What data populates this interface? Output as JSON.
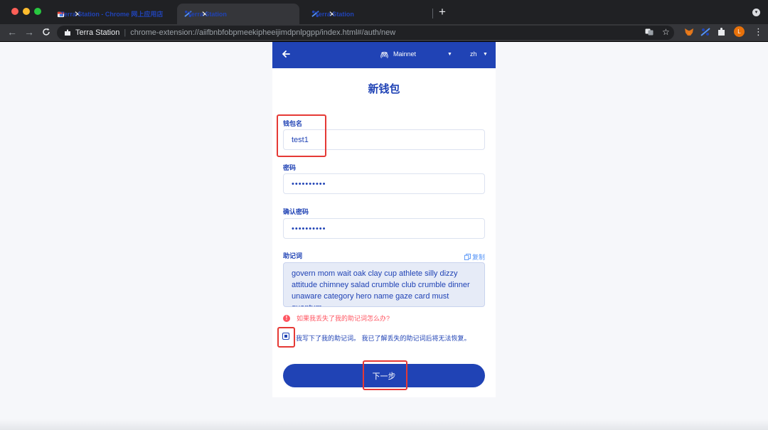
{
  "browser": {
    "tabs": [
      {
        "title": "Terra Station - Chrome 网上应用店",
        "active": false
      },
      {
        "title": "Terra Station",
        "active": true
      },
      {
        "title": "Terra Station",
        "active": false
      }
    ],
    "omnibox": {
      "site": "Terra Station",
      "url": "chrome-extension://aiifbnbfobpmeekipheeijimdpnlpgpp/index.html#/auth/new"
    },
    "avatar_letter": "L"
  },
  "header": {
    "network": "Mainnet",
    "language": "zh"
  },
  "form": {
    "title": "新钱包",
    "wallet_name_label": "钱包名",
    "wallet_name_value": "test1",
    "password_label": "密码",
    "password_value": "••••••••••",
    "confirm_label": "确认密码",
    "confirm_value": "••••••••••",
    "mnemonic_label": "助记词",
    "copy_label": "复制",
    "mnemonic_text": "govern mom wait oak clay cup athlete silly dizzy attitude chimney salad crumble club crumble dinner unaware category hero name gaze card must quantum",
    "warning": "如果我丢失了我的助记词怎么办?",
    "checkbox_label": "我写下了我的助记词。 我已了解丢失的助记词后将无法恢复。",
    "checkbox_checked": true,
    "next_button": "下一步"
  },
  "colors": {
    "brand": "#2043b5",
    "warning": "#ff5561",
    "annotation": "#e53935"
  }
}
